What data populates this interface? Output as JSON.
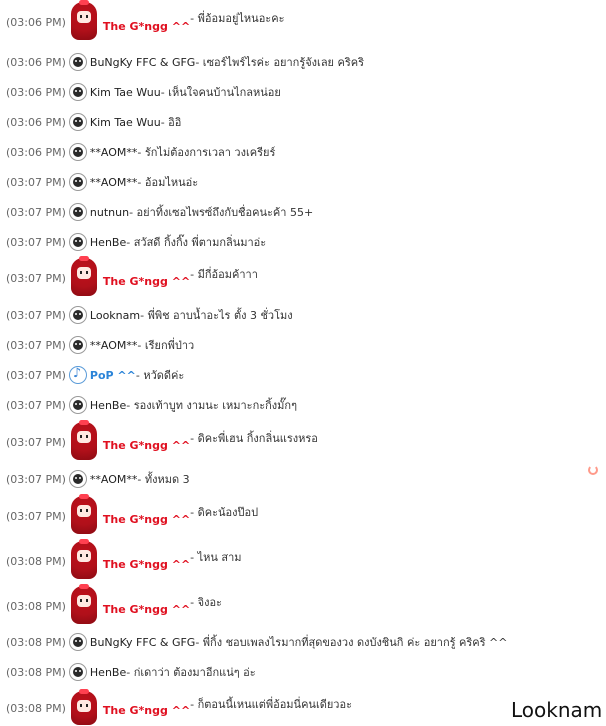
{
  "watermark": "Looknam",
  "messages": [
    {
      "time": "(03:06 PM)",
      "user": "The G*ngg ^^",
      "style": "gangg",
      "text": " - พี่อ้อมอยู่ไหนอะคะ"
    },
    {
      "time": "(03:06 PM)",
      "user": "BuNgKy FFC & GFG",
      "style": "normal",
      "text": " - เซอร์ไพร์ไรค่ะ อยากรู้จังเลย คริคริ"
    },
    {
      "time": "(03:06 PM)",
      "user": "Kim Tae Wuu",
      "style": "normal",
      "text": " - เห็นใจคนบ้านไกลหน่อย"
    },
    {
      "time": "(03:06 PM)",
      "user": "Kim Tae Wuu",
      "style": "normal",
      "text": " - อิอิ"
    },
    {
      "time": "(03:06 PM)",
      "user": "**AOM**",
      "style": "normal",
      "text": " - รักไม่ต้องการเวลา วงเครียร์"
    },
    {
      "time": "(03:07 PM)",
      "user": "**AOM**",
      "style": "normal",
      "text": " - อ้อมไหนอ่ะ"
    },
    {
      "time": "(03:07 PM)",
      "user": "nutnun",
      "style": "normal",
      "text": " - อย่าทิ้งเซอไพรซ์ถึงกับชื่อคนะค้า 55+"
    },
    {
      "time": "(03:07 PM)",
      "user": "HenBe",
      "style": "normal",
      "text": " - สวัสดี กิ้งกิ๊ง พี่ตามกลิ่นมาอ่ะ"
    },
    {
      "time": "(03:07 PM)",
      "user": "The G*ngg ^^",
      "style": "gangg",
      "text": " - มีกี่อ้อมค้าาา"
    },
    {
      "time": "(03:07 PM)",
      "user": "Looknam",
      "style": "normal",
      "text": " - พี่พิช อาบน้ำอะไร ตั้ง 3 ชั่วโมง"
    },
    {
      "time": "(03:07 PM)",
      "user": "**AOM**",
      "style": "normal",
      "text": " - เรียกพี่ป่าว"
    },
    {
      "time": "(03:07 PM)",
      "user": "PoP ^^",
      "style": "pop",
      "text": " - หวัดดีค่ะ"
    },
    {
      "time": "(03:07 PM)",
      "user": "HenBe",
      "style": "normal",
      "text": " - รองเท้าบูท งามนะ เหมาะกะกิ้งมั๊กๆ"
    },
    {
      "time": "(03:07 PM)",
      "user": "The G*ngg ^^",
      "style": "gangg",
      "text": " - ดิคะพี่เฮน กิ้งกลิ่นแรงหรอ"
    },
    {
      "time": "(03:07 PM)",
      "user": "**AOM**",
      "style": "normal",
      "text": " - ทั้งหมด 3"
    },
    {
      "time": "(03:07 PM)",
      "user": "The G*ngg ^^",
      "style": "gangg",
      "text": " - ดิคะน้องป๊อป"
    },
    {
      "time": "(03:08 PM)",
      "user": "The G*ngg ^^",
      "style": "gangg",
      "text": " - ไหน สาม"
    },
    {
      "time": "(03:08 PM)",
      "user": "The G*ngg ^^",
      "style": "gangg",
      "text": " - จิงอะ"
    },
    {
      "time": "(03:08 PM)",
      "user": "BuNgKy FFC & GFG",
      "style": "normal",
      "text": " - พี่กิ้ง ชอบเพลงไรมากที่สุดของวง ดงบังชินกิ ค่ะ อยากรู้ คริคริ ^^"
    },
    {
      "time": "(03:08 PM)",
      "user": "HenBe",
      "style": "normal",
      "text": " - ก่เดาว่า ต้องมาอีกแน่ๆ อ่ะ"
    },
    {
      "time": "(03:08 PM)",
      "user": "The G*ngg ^^",
      "style": "gangg",
      "text": " - ก็ตอนนี้เหนแต่พี่อ้อมนี่คนเดียวอะ"
    }
  ]
}
